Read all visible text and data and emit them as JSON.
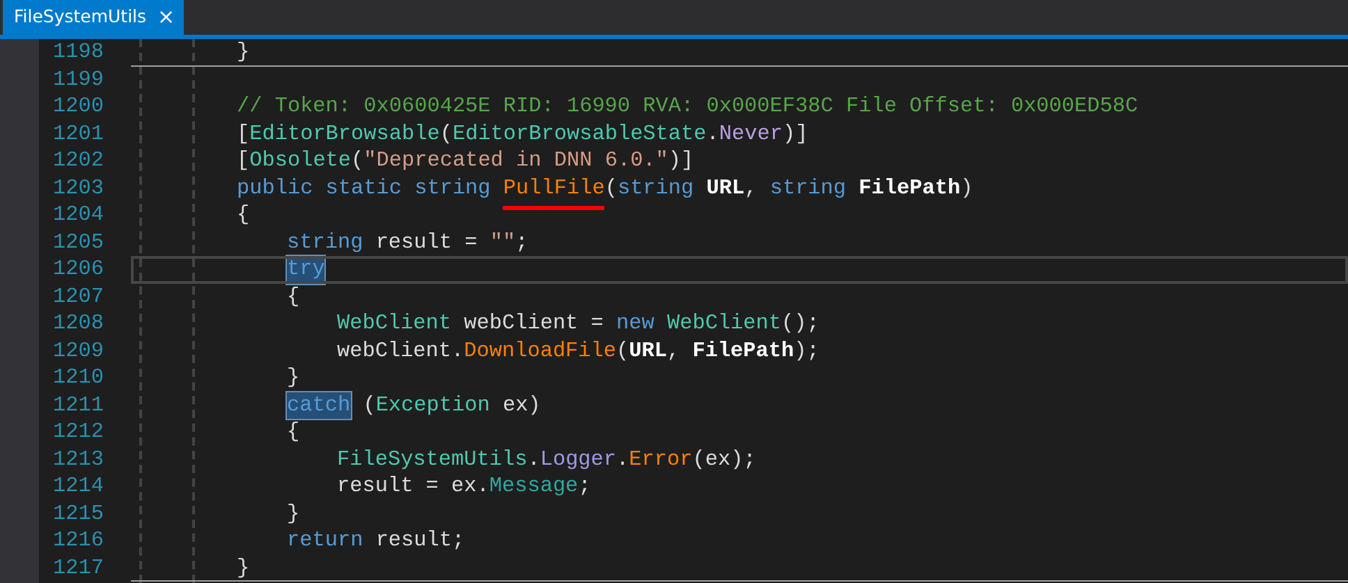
{
  "tabs": [
    {
      "label": "FileSystemUtils",
      "selected": true,
      "close": "×"
    }
  ],
  "lines": [
    {
      "number": "1198",
      "separator_below": true,
      "tokens": [
        {
          "text": "}",
          "kind": "plain"
        }
      ]
    },
    {
      "number": "1199"
    },
    {
      "number": "1200",
      "tokens": [
        {
          "text": "// Token: 0x0600425E RID: 16990 RVA: 0x000EF38C File Offset: 0x000ED58C",
          "kind": "comment"
        }
      ]
    },
    {
      "number": "1201",
      "tokens": [
        {
          "text": "[",
          "kind": "plain"
        },
        {
          "text": "EditorBrowsable",
          "kind": "type"
        },
        {
          "text": "(",
          "kind": "plain"
        },
        {
          "text": "EditorBrowsableState",
          "kind": "type"
        },
        {
          "text": ".",
          "kind": "plain"
        },
        {
          "text": "Never",
          "kind": "enum"
        },
        {
          "text": ")]",
          "kind": "plain"
        }
      ]
    },
    {
      "number": "1202",
      "tokens": [
        {
          "text": "[",
          "kind": "plain"
        },
        {
          "text": "Obsolete",
          "kind": "type"
        },
        {
          "text": "(",
          "kind": "plain"
        },
        {
          "text": "\"Deprecated in DNN 6.0.\"",
          "kind": "string"
        },
        {
          "text": ")]",
          "kind": "plain"
        }
      ]
    },
    {
      "number": "1203",
      "tokens": [
        {
          "text": "public static string ",
          "kind": "keyword"
        },
        {
          "text": "PullFile",
          "kind": "method",
          "underlined": true
        },
        {
          "text": "(",
          "kind": "plain"
        },
        {
          "text": "string ",
          "kind": "keyword"
        },
        {
          "text": "URL",
          "kind": "param"
        },
        {
          "text": ", ",
          "kind": "plain"
        },
        {
          "text": "string ",
          "kind": "keyword"
        },
        {
          "text": "FilePath",
          "kind": "param"
        },
        {
          "text": ")",
          "kind": "plain"
        }
      ]
    },
    {
      "number": "1204",
      "tokens": [
        {
          "text": "{",
          "kind": "plain"
        }
      ],
      "children": [
        {
          "number": "1205",
          "tokens": [
            {
              "text": "string ",
              "kind": "keyword"
            },
            {
              "text": "result = ",
              "kind": "plain"
            },
            {
              "text": "\"\"",
              "kind": "string"
            },
            {
              "text": ";",
              "kind": "plain"
            }
          ]
        },
        {
          "number": "1206",
          "current": true,
          "tokens": [
            {
              "text": "try",
              "kind": "keyword",
              "highlighted": true
            }
          ]
        },
        {
          "number": "1207",
          "tokens": [
            {
              "text": "{",
              "kind": "plain"
            }
          ],
          "children": [
            {
              "number": "1208",
              "tokens": [
                {
                  "text": "WebClient ",
                  "kind": "type"
                },
                {
                  "text": "webClient = ",
                  "kind": "plain"
                },
                {
                  "text": "new ",
                  "kind": "keyword"
                },
                {
                  "text": "WebClient",
                  "kind": "type"
                },
                {
                  "text": "();",
                  "kind": "plain"
                }
              ]
            },
            {
              "number": "1209",
              "tokens": [
                {
                  "text": "webClient.",
                  "kind": "plain"
                },
                {
                  "text": "DownloadFile",
                  "kind": "method"
                },
                {
                  "text": "(",
                  "kind": "plain"
                },
                {
                  "text": "URL",
                  "kind": "param"
                },
                {
                  "text": ", ",
                  "kind": "plain"
                },
                {
                  "text": "FilePath",
                  "kind": "param"
                },
                {
                  "text": ");",
                  "kind": "plain"
                }
              ]
            }
          ]
        },
        {
          "number": "1210",
          "tokens": [
            {
              "text": "}",
              "kind": "plain"
            }
          ]
        },
        {
          "number": "1211",
          "tokens": [
            {
              "text": "catch",
              "kind": "keyword",
              "highlighted": true
            },
            {
              "text": " (",
              "kind": "plain"
            },
            {
              "text": "Exception ",
              "kind": "type"
            },
            {
              "text": "ex)",
              "kind": "plain"
            }
          ]
        },
        {
          "number": "1212",
          "tokens": [
            {
              "text": "{",
              "kind": "plain"
            }
          ],
          "children": [
            {
              "number": "1213",
              "tokens": [
                {
                  "text": "FileSystemUtils",
                  "kind": "type"
                },
                {
                  "text": ".",
                  "kind": "plain"
                },
                {
                  "text": "Logger",
                  "kind": "property"
                },
                {
                  "text": ".",
                  "kind": "plain"
                },
                {
                  "text": "Error",
                  "kind": "method"
                },
                {
                  "text": "(ex);",
                  "kind": "plain"
                }
              ]
            },
            {
              "number": "1214",
              "tokens": [
                {
                  "text": "result = ex.",
                  "kind": "plain"
                },
                {
                  "text": "Message",
                  "kind": "member"
                },
                {
                  "text": ";",
                  "kind": "plain"
                }
              ]
            }
          ]
        },
        {
          "number": "1215",
          "tokens": [
            {
              "text": "}",
              "kind": "plain"
            }
          ]
        },
        {
          "number": "1216",
          "tokens": [
            {
              "text": "return ",
              "kind": "keyword"
            },
            {
              "text": "result;",
              "kind": "plain"
            }
          ]
        }
      ]
    },
    {
      "number": "1217",
      "separator_below": true,
      "tokens": [
        {
          "text": "}",
          "kind": "plain"
        }
      ]
    }
  ]
}
